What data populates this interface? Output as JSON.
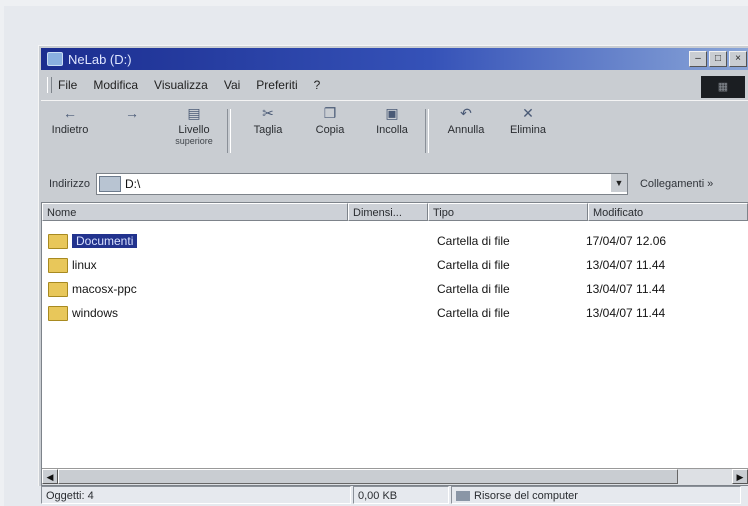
{
  "window": {
    "title": "NeLab (D:)"
  },
  "menu": [
    "File",
    "Modifica",
    "Visualizza",
    "Vai",
    "Preferiti",
    "?"
  ],
  "toolbar": {
    "back": "Indietro",
    "up_line1": "Livello",
    "up_line2": "superiore",
    "cut": "Taglia",
    "copy": "Copia",
    "paste": "Incolla",
    "undo": "Annulla",
    "delete": "Elimina"
  },
  "address": {
    "label": "Indirizzo",
    "value": "D:\\",
    "links": "Collegamenti"
  },
  "columns": {
    "name": "Nome",
    "size": "Dimensi...",
    "type": "Tipo",
    "modified": "Modificato"
  },
  "files": [
    {
      "name": "Documenti",
      "type": "Cartella di file",
      "modified": "17/04/07 12.06",
      "selected": true
    },
    {
      "name": "linux",
      "type": "Cartella di file",
      "modified": "13/04/07 11.44"
    },
    {
      "name": "macosx-ppc",
      "type": "Cartella di file",
      "modified": "13/04/07 11.44"
    },
    {
      "name": "windows",
      "type": "Cartella di file",
      "modified": "13/04/07 11.44"
    }
  ],
  "status": {
    "objects": "Oggetti: 4",
    "size": "0,00 KB",
    "location": "Risorse del computer"
  }
}
